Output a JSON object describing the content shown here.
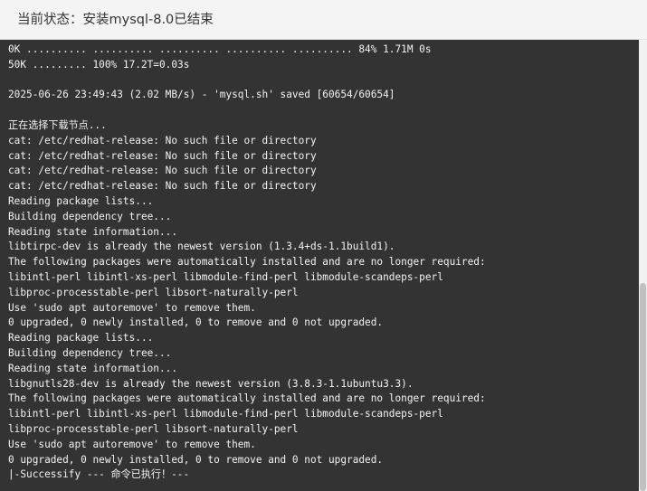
{
  "header": {
    "title": "当前状态：安装mysql-8.0已结束"
  },
  "terminal": {
    "lines": [
      "0K .......... .......... .......... .......... .......... 84% 1.71M 0s",
      "50K ......... 100% 17.2T=0.03s",
      "",
      "2025-06-26 23:49:43 (2.02 MB/s) - 'mysql.sh' saved [60654/60654]",
      "",
      "正在选择下载节点...",
      "cat: /etc/redhat-release: No such file or directory",
      "cat: /etc/redhat-release: No such file or directory",
      "cat: /etc/redhat-release: No such file or directory",
      "cat: /etc/redhat-release: No such file or directory",
      "Reading package lists...",
      "Building dependency tree...",
      "Reading state information...",
      "libtirpc-dev is already the newest version (1.3.4+ds-1.1build1).",
      "The following packages were automatically installed and are no longer required:",
      "libintl-perl libintl-xs-perl libmodule-find-perl libmodule-scandeps-perl",
      "libproc-processtable-perl libsort-naturally-perl",
      "Use 'sudo apt autoremove' to remove them.",
      "0 upgraded, 0 newly installed, 0 to remove and 0 not upgraded.",
      "Reading package lists...",
      "Building dependency tree...",
      "Reading state information...",
      "libgnutls28-dev is already the newest version (3.8.3-1.1ubuntu3.3).",
      "The following packages were automatically installed and are no longer required:",
      "libintl-perl libintl-xs-perl libmodule-find-perl libmodule-scandeps-perl",
      "libproc-processtable-perl libsort-naturally-perl",
      "Use 'sudo apt autoremove' to remove them.",
      "0 upgraded, 0 newly installed, 0 to remove and 0 not upgraded.",
      "|-Successify --- 命令已执行！---"
    ]
  },
  "colors": {
    "header_bg": "#f4f4f4",
    "terminal_bg": "#333333",
    "terminal_text": "#f3f3f3",
    "scrollbar_thumb": "#c1c1c1"
  }
}
